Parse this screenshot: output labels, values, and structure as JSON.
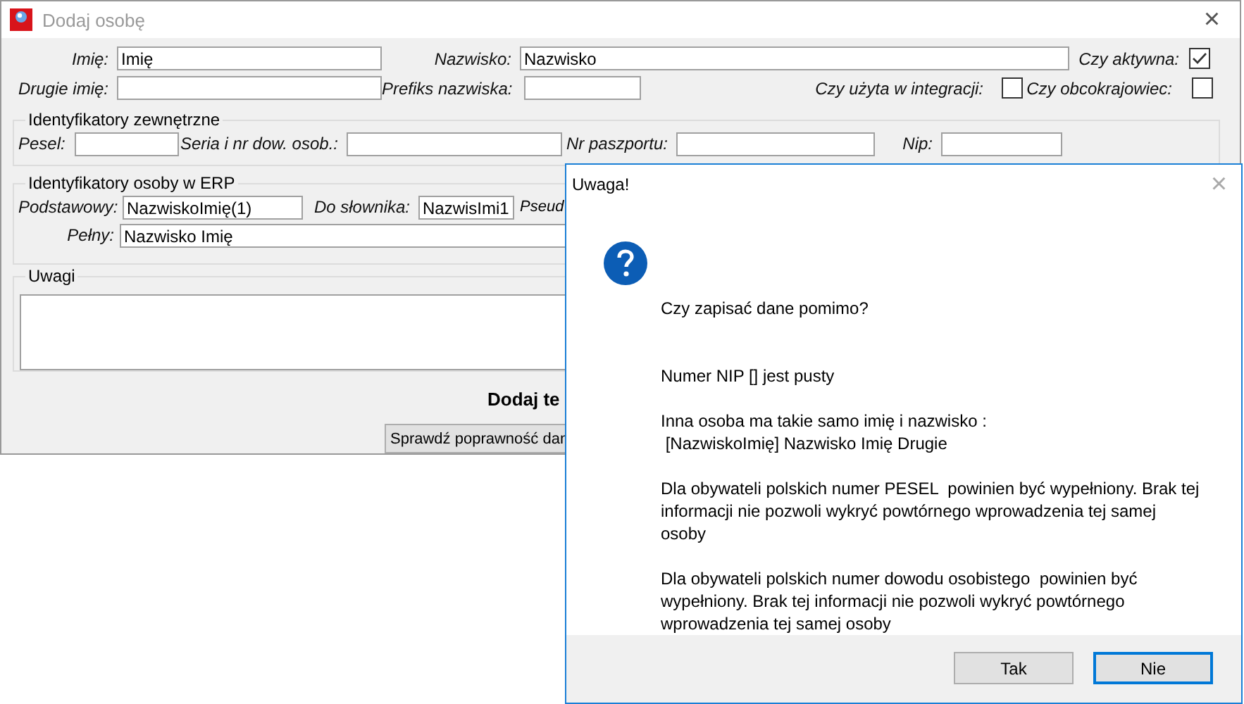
{
  "window": {
    "title": "Dodaj osobę",
    "close": "×"
  },
  "row_1": {
    "first_name": {
      "label": "Imię:",
      "value": "Imię"
    },
    "last_name": {
      "label": "Nazwisko:",
      "value": "Nazwisko"
    },
    "active": {
      "label": "Czy aktywna:",
      "checked": true
    }
  },
  "row_2": {
    "middle_name": {
      "label": "Drugie imię:"
    },
    "prefix": {
      "label": "Prefiks nazwiska:"
    },
    "integration": {
      "label": "Czy użyta w integracji:",
      "checked": false
    },
    "foreigner": {
      "label": "Czy obcokrajowiec:",
      "checked": false
    }
  },
  "external_ids": {
    "title": "Identyfikatory zewnętrzne",
    "pesel": {
      "label": "Pesel:"
    },
    "id_card": {
      "label": "Seria i nr dow. osob.:"
    },
    "passport": {
      "label": "Nr paszportu:"
    },
    "nip": {
      "label": "Nip:"
    }
  },
  "erp_ids": {
    "title": "Identyfikatory osoby w ERP",
    "basic": {
      "label": "Podstawowy:",
      "value": "NazwiskoImię(1)"
    },
    "dictionary": {
      "label": "Do słownika:",
      "value": "NazwisImi1"
    },
    "column_3_label": "Pseud",
    "full": {
      "label": "Pełny:",
      "value": "Nazwisko Imię"
    }
  },
  "notes": {
    "title": "Uwagi"
  },
  "heading": "Dodaj te",
  "check_button": "Sprawdź poprawność dan",
  "dialog": {
    "title": "Uwaga!",
    "close": "×",
    "message": "Czy zapisać dane pomimo?\n\n\nNumer NIP [] jest pusty\n\nInna osoba ma takie samo imię i nazwisko :\n [NazwiskoImię] Nazwisko Imię Drugie\n\nDla obywateli polskich numer PESEL  powinien być wypełniony. Brak tej informacji nie pozwoli wykryć powtórnego wprowadzenia tej samej osoby\n\nDla obywateli polskich numer dowodu osobistego  powinien być wypełniony. Brak tej informacji nie pozwoli wykryć powtórnego wprowadzenia tej samej osoby",
    "buttons": [
      {
        "label": "Tak",
        "selected": false
      },
      {
        "label": "Nie",
        "selected": true
      }
    ]
  }
}
